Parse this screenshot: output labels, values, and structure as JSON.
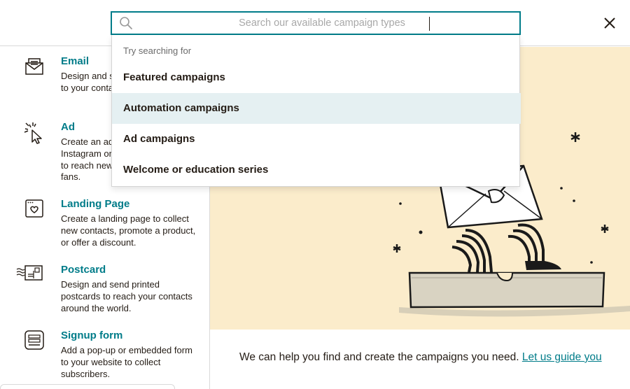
{
  "search": {
    "placeholder": "Search our available campaign types",
    "hint": "Try searching for",
    "options": [
      {
        "label": "Featured campaigns"
      },
      {
        "label": "Automation campaigns",
        "highlighted": true
      },
      {
        "label": "Ad campaigns"
      },
      {
        "label": "Welcome or education series"
      }
    ]
  },
  "campaign_types": [
    {
      "title": "Email",
      "icon": "envelope-icon",
      "description": "Design and send regular emails to your contacts."
    },
    {
      "title": "Ad",
      "icon": "cursor-click-icon",
      "description": "Create an ad for Facebook, Instagram or the Google network to reach new customers and fans."
    },
    {
      "title": "Landing Page",
      "icon": "landing-page-icon",
      "description": "Create a landing page to collect new contacts, promote a product, or offer a discount."
    },
    {
      "title": "Postcard",
      "icon": "postcard-icon",
      "description": "Design and send printed postcards to reach your contacts around the world."
    },
    {
      "title": "Signup form",
      "icon": "signup-form-icon",
      "description": "Add a pop-up or embedded form to your website to collect subscribers."
    }
  ],
  "guide": {
    "text": "We can help you find and create the campaigns you need. ",
    "link": "Let us guide you"
  },
  "colors": {
    "accent": "#007c89",
    "illustration_bg": "#fbeccb",
    "highlight": "#e5f0f2",
    "text": "#241c15"
  }
}
